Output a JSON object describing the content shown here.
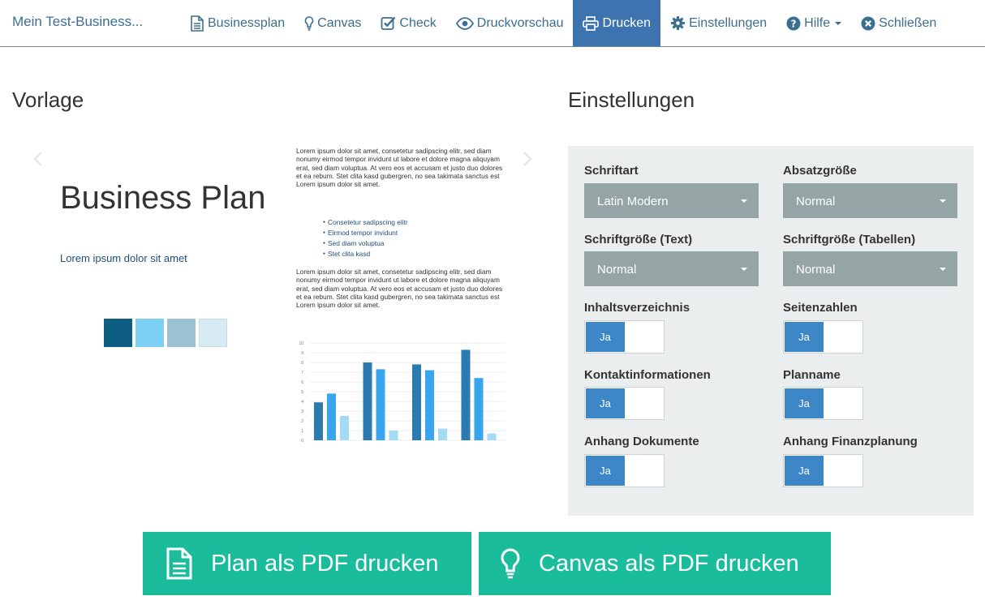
{
  "brand": "Mein Test-Business...",
  "nav": {
    "businessplan": "Businessplan",
    "canvas": "Canvas",
    "check": "Check",
    "druckvorschau": "Druckvorschau",
    "drucken": "Drucken",
    "einstellungen": "Einstellungen",
    "hilfe": "Hilfe",
    "schliessen": "Schließen"
  },
  "vorlage": {
    "heading": "Vorlage",
    "title": "Business Plan",
    "subtitle": "Lorem ipsum dolor sit amet",
    "swatches": [
      "#0e5e84",
      "#7fd0f5",
      "#9bc2d2",
      "#d6ebf4"
    ],
    "paragraph1": "Lorem ipsum dolor sit amet, consetetur sadipscing elitr, sed diam nonumy eirmod tempor invidunt ut labore et dolore magna aliquyam erat, sed diam voluptua. At vero eos et accusam et justo duo dolores et ea rebum. Stet clita kasd gubergren, no sea takimata sanctus est Lorem ipsum dolor sit amet.",
    "list": [
      "Consetetur sadipscing elitr",
      "Eirmod tempor invidunt",
      "Sed diam voluptua",
      "Stet clita kasd"
    ],
    "paragraph2": "Lorem ipsum dolor sit amet, consetetur sadipscing elitr, sed diam nonumy eirmod tempor invidunt ut labore et dolore magna aliquyam erat, sed diam voluptua. At vero eos et accusam et justo duo dolores et ea rebum. Stet clita kasd gubergren, no sea takimata sanctus est Lorem ipsum dolor sit amet.",
    "mini_chart": {
      "y_ticks": [
        "10",
        "9",
        "8",
        "7",
        "6",
        "5",
        "4",
        "3",
        "2",
        "1",
        "0"
      ],
      "groups": [
        [
          3.9,
          4.8,
          2.5
        ],
        [
          8.0,
          7.3,
          1.0
        ],
        [
          7.8,
          7.2,
          1.2
        ],
        [
          9.3,
          6.4,
          0.7
        ]
      ],
      "colors": [
        "#2b7bb0",
        "#37a6ee",
        "#a3dbf7"
      ]
    }
  },
  "settings": {
    "heading": "Einstellungen",
    "schriftart_label": "Schriftart",
    "schriftart_value": "Latin Modern",
    "absatz_label": "Absatzgröße",
    "absatz_value": "Normal",
    "schriftgroesse_text_label": "Schriftgröße (Text)",
    "schriftgroesse_text_value": "Normal",
    "schriftgroesse_tab_label": "Schriftgröße (Tabellen)",
    "schriftgroesse_tab_value": "Normal",
    "inhaltsverzeichnis_label": "Inhaltsverzeichnis",
    "seitenzahlen_label": "Seitenzahlen",
    "kontakt_label": "Kontaktinformationen",
    "planname_label": "Planname",
    "anhang_dok_label": "Anhang Dokumente",
    "anhang_fin_label": "Anhang Finanzplanung",
    "toggle_on": "Ja"
  },
  "actions": {
    "plan_pdf": "Plan als PDF drucken",
    "canvas_pdf": "Canvas als PDF drucken"
  },
  "colors": {
    "accent": "#3d74b0",
    "green": "#1abc9c",
    "select_bg": "#95a5a6",
    "toggle_on": "#3d87c9"
  }
}
